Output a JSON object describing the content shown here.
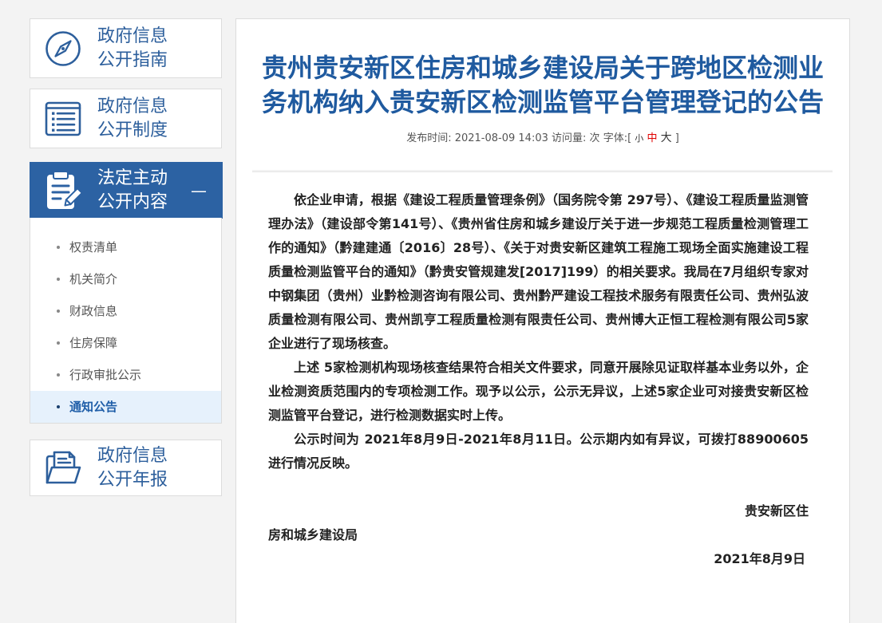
{
  "sidebar": {
    "boxes": [
      {
        "line1": "政府信息",
        "line2": "公开指南",
        "icon": "compass-icon"
      },
      {
        "line1": "政府信息",
        "line2": "公开制度",
        "icon": "list-document-icon"
      },
      {
        "line1": "法定主动",
        "line2": "公开内容",
        "icon": "clipboard-edit-icon",
        "toggle": "—",
        "expanded": true
      },
      {
        "line1": "政府信息",
        "line2": "公开年报",
        "icon": "folder-document-icon"
      }
    ],
    "submenu": [
      {
        "label": "权责清单",
        "active": false
      },
      {
        "label": "机关简介",
        "active": false
      },
      {
        "label": "财政信息",
        "active": false
      },
      {
        "label": "住房保障",
        "active": false
      },
      {
        "label": "行政审批公示",
        "active": false
      },
      {
        "label": "通知公告",
        "active": true
      }
    ]
  },
  "article": {
    "title": "贵州贵安新区住房和城乡建设局关于跨地区检测业务机构纳入贵安新区检测监管平台管理登记的公告",
    "meta": {
      "publish_label": "发布时间:",
      "publish_time": "2021-08-09 14:03",
      "visits_label": "访问量:",
      "visits_unit": "次",
      "font_label_open": "字体:[",
      "font_small": "小",
      "font_medium": "中",
      "font_large": "大",
      "font_label_close": "]"
    },
    "paragraphs": [
      "依企业申请，根据《建设工程质量管理条例》（国务院令第 297号）、《建设工程质量监测管理办法》（建设部令第141号）、《贵州省住房和城乡建设厅关于进一步规范工程质量检测管理工作的通知》（黔建建通〔2016〕28号）、《关于对贵安新区建筑工程施工现场全面实施建设工程质量检测监管平台的通知》（黔贵安管规建发[2017]199）的相关要求。我局在7月组织专家对中钢集团（贵州）业黔检测咨询有限公司、贵州黔严建设工程技术服务有限责任公司、贵州弘波质量检测有限公司、贵州凯亨工程质量检测有限责任公司、贵州博大正恒工程检测有限公司5家企业进行了现场核查。",
      "上述 5家检测机构现场核查结果符合相关文件要求，同意开展除见证取样基本业务以外，企业检测资质范围内的专项检测工作。现予以公示，公示无异议，上述5家企业可对接贵安新区检测监管平台登记，进行检测数据实时上传。",
      "公示时间为 2021年8月9日-2021年8月11日。公示期内如有异议，可拨打88900605进行情况反映。"
    ],
    "signature": {
      "line1": "贵安新区住",
      "line2": "房和城乡建设局",
      "date": "2021年8月9日"
    }
  },
  "colors": {
    "page_background": "#f3f3f3",
    "sidebar_text": "#2d5f9c",
    "active_box": "#2c62a3",
    "active_submenu_bg": "#e6f1fc",
    "active_submenu_text": "#1f5ea8",
    "title": "#1f5a9f",
    "font_medium_highlight": "#e00000"
  }
}
